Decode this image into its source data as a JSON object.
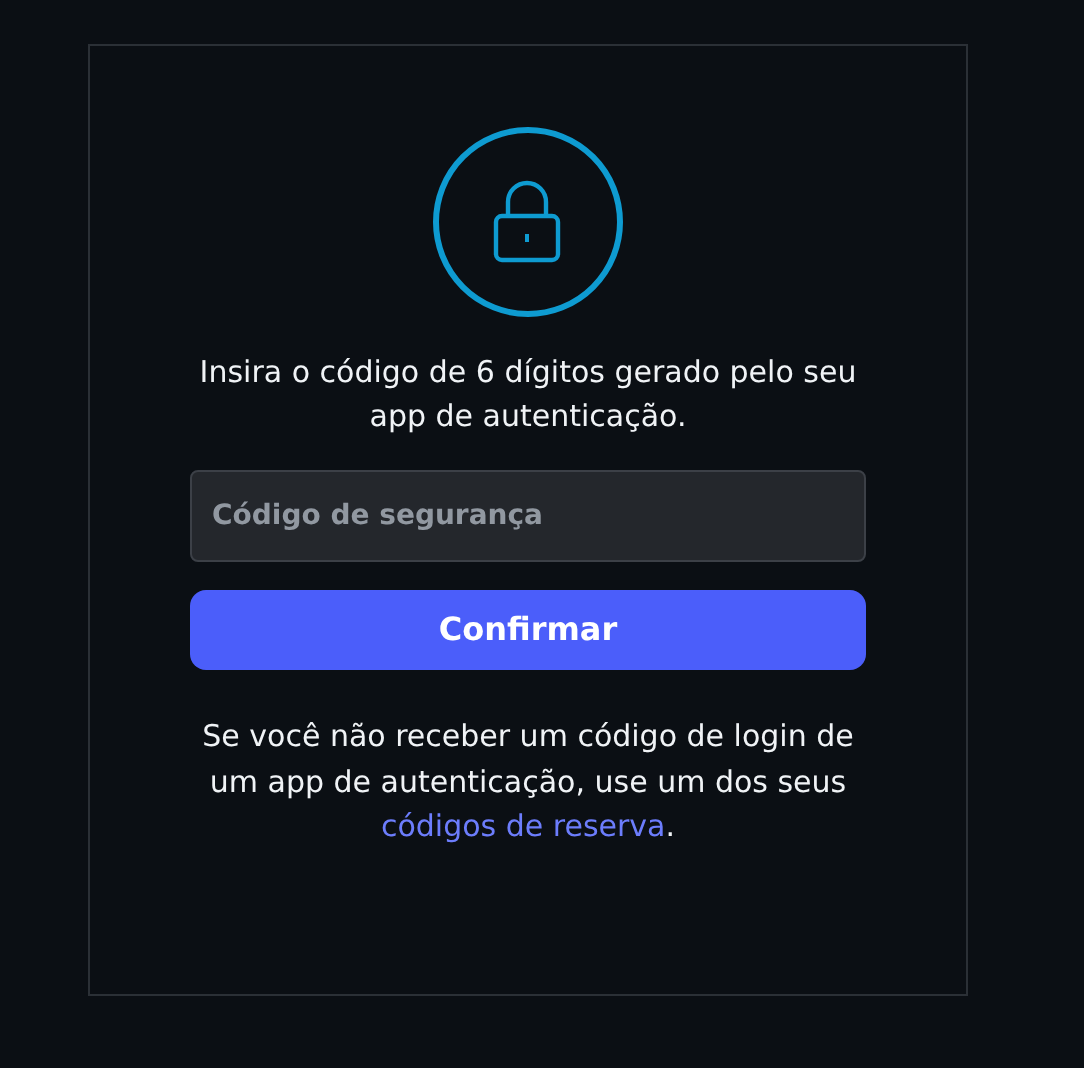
{
  "prompt": "Insira o código de 6 dígitos gerado pelo seu app de autenticação.",
  "code_field": {
    "placeholder": "Código de segurança"
  },
  "confirm_button": "Confirmar",
  "help": {
    "text": "Se você não receber um código de login de um app de autenticação, use um dos seus",
    "link": "códigos de reserva",
    "end": "."
  }
}
